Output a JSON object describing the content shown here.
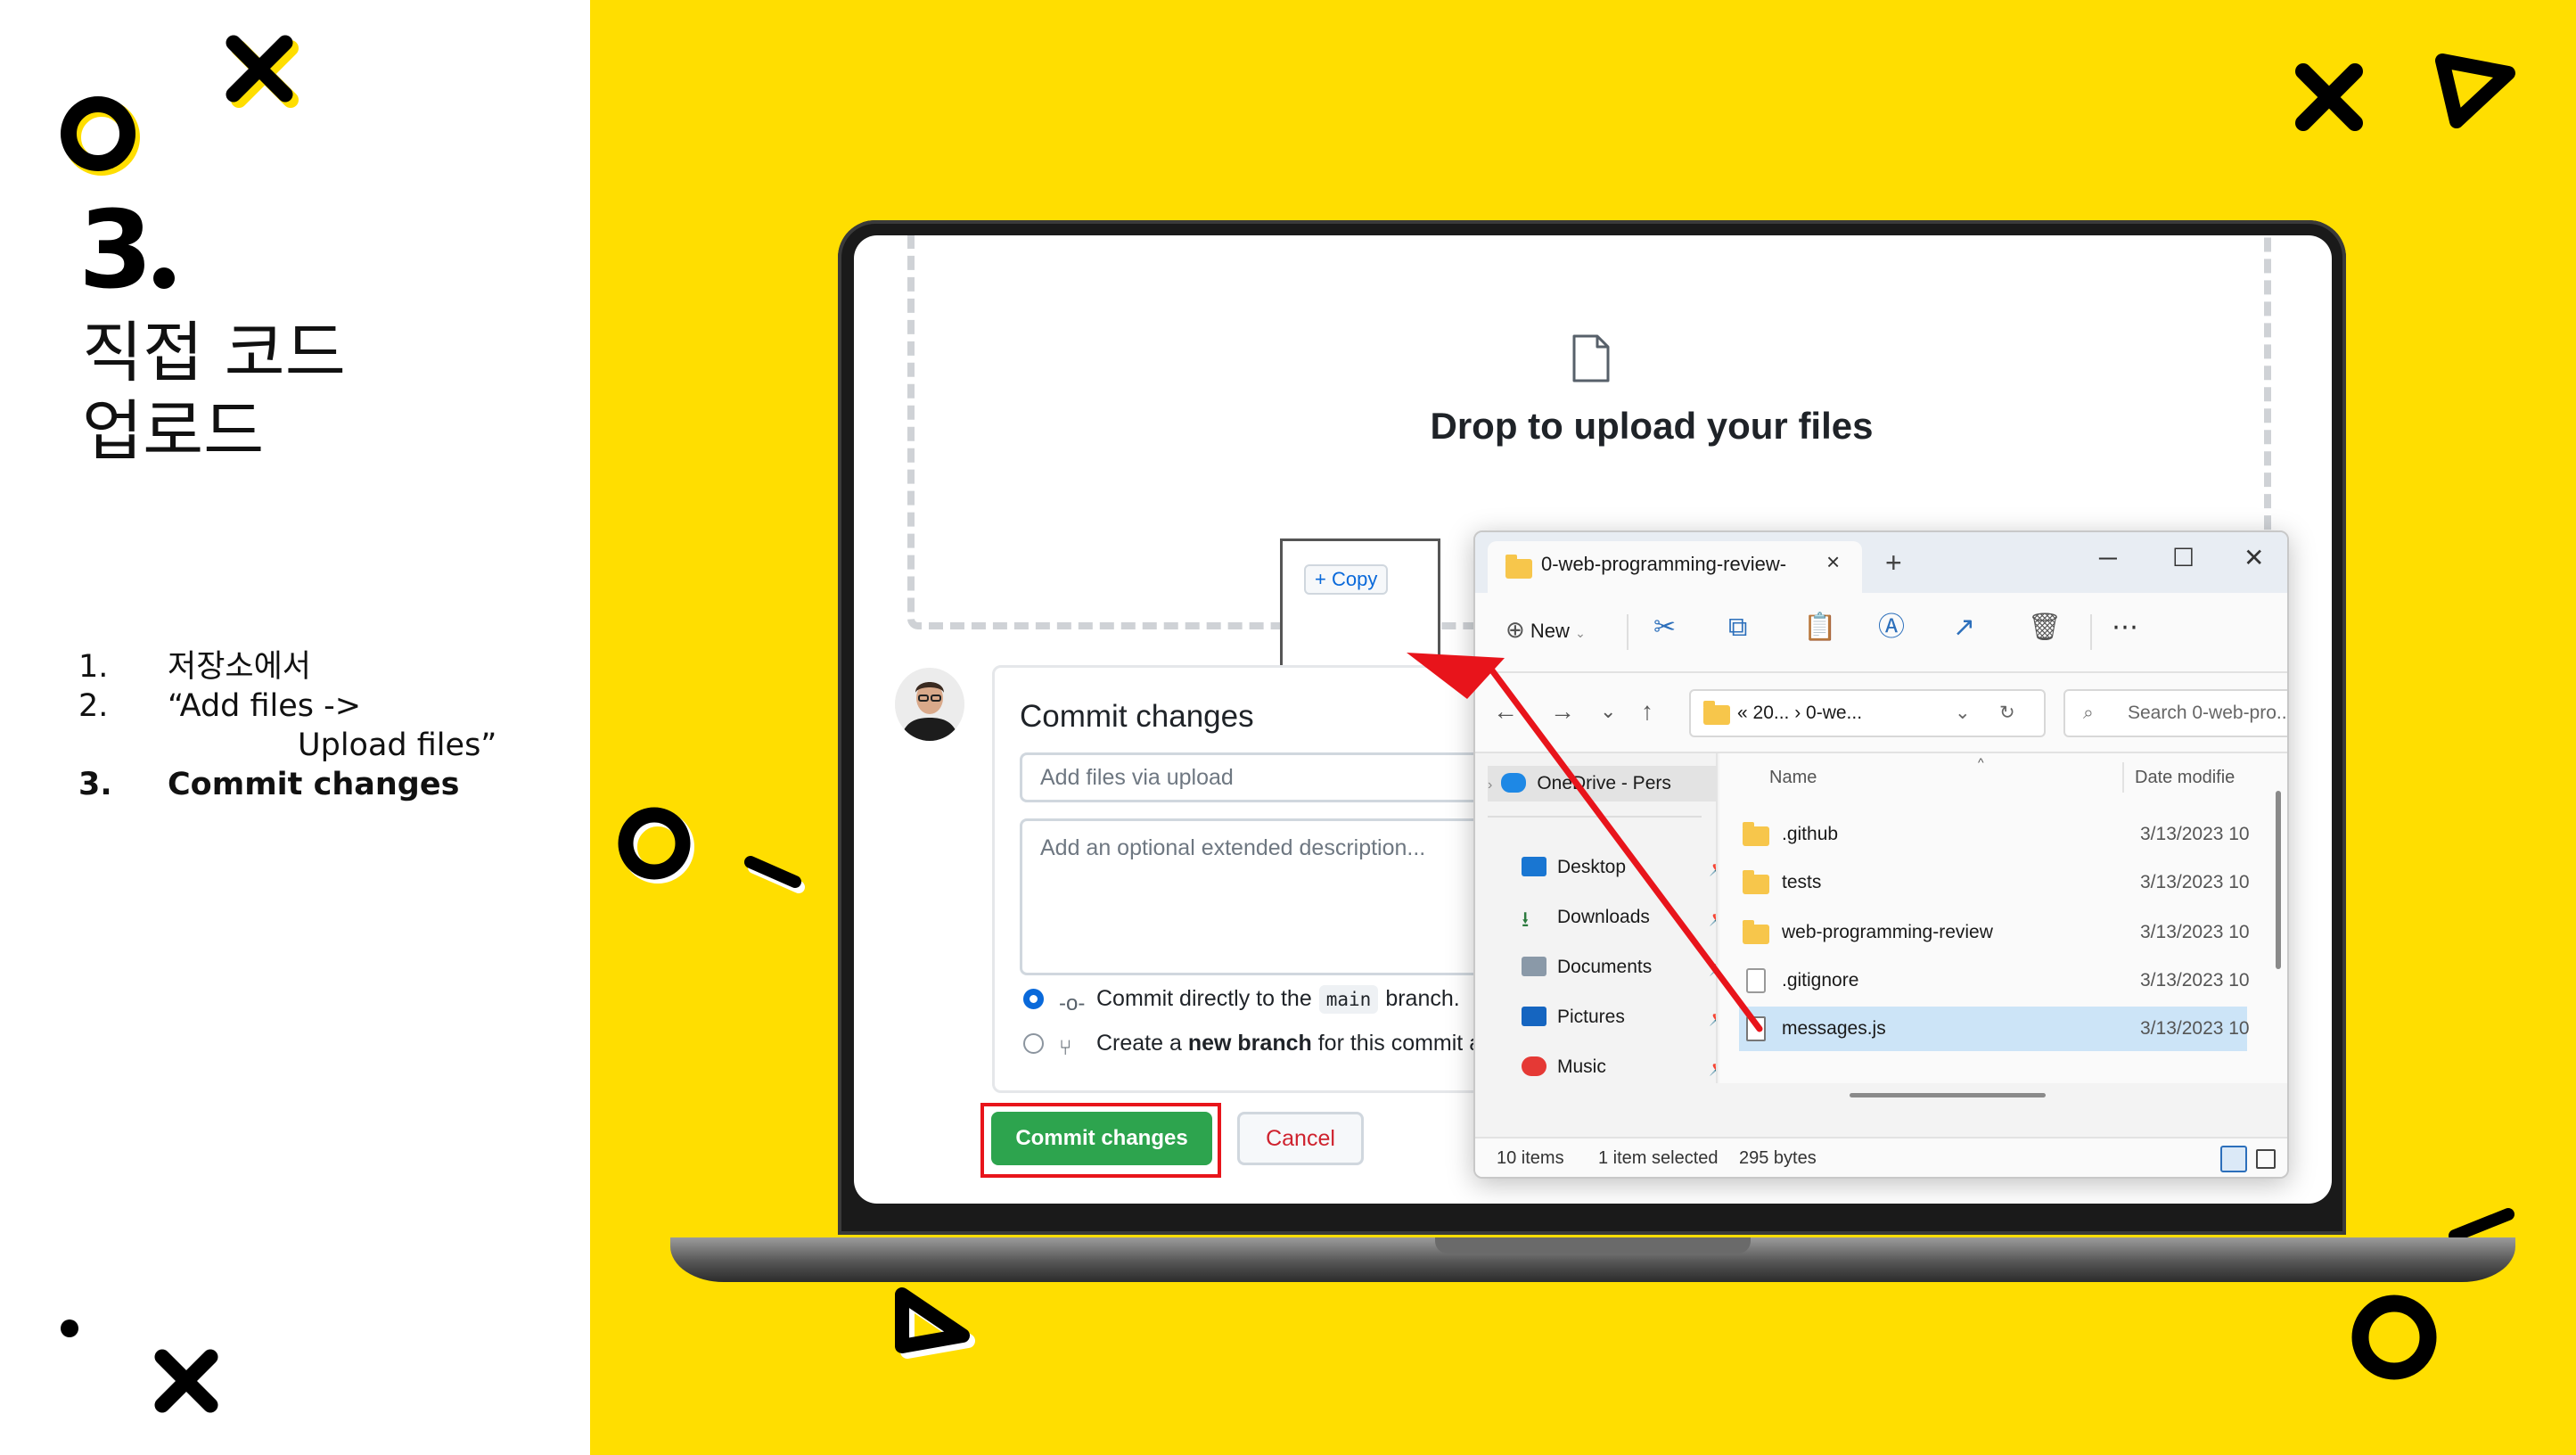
{
  "slide": {
    "number": "3",
    "title_line1": "직접 코드",
    "title_line2": "업로드",
    "steps": [
      {
        "num": "1.",
        "text": "저장소에서"
      },
      {
        "num": "2.",
        "text": "“Add files ->"
      },
      {
        "num": "",
        "text": "Upload files”"
      },
      {
        "num": "3.",
        "text": "Commit changes"
      }
    ]
  },
  "colors": {
    "background_accent": "#FFDE00",
    "commit_button": "#2da44e",
    "highlight": "#e8141b"
  },
  "github": {
    "drop_title": "Drop to upload your files",
    "drag_badge": "+ Copy",
    "commit_heading": "Commit changes",
    "summary_placeholder": "Add files via upload",
    "description_placeholder": "Add an optional extended description...",
    "option_direct_pre": "Commit directly to the",
    "option_direct_branch": "main",
    "option_direct_post": "branch.",
    "option_new_pre": "Create a",
    "option_new_bold": "new branch",
    "option_new_post": "for this commit ar",
    "commit_button": "Commit changes",
    "cancel_button": "Cancel"
  },
  "explorer": {
    "tab_title": "0-web-programming-review-",
    "tab_close": "×",
    "new_tab": "+",
    "new_label": "New",
    "breadcrumb": "«  20...  ›  0-we...",
    "search_placeholder": "Search 0-web-pro...",
    "columns": {
      "name": "Name",
      "date": "Date modifie"
    },
    "nav_items": [
      {
        "label": "OneDrive - Pers",
        "icon": "cloud-icon"
      },
      {
        "label": "Desktop",
        "icon": "desktop-icon"
      },
      {
        "label": "Downloads",
        "icon": "download-icon"
      },
      {
        "label": "Documents",
        "icon": "documents-icon"
      },
      {
        "label": "Pictures",
        "icon": "pictures-icon"
      },
      {
        "label": "Music",
        "icon": "music-icon"
      }
    ],
    "files": [
      {
        "name": ".github",
        "date": "3/13/2023 10",
        "kind": "folder"
      },
      {
        "name": "tests",
        "date": "3/13/2023 10",
        "kind": "folder"
      },
      {
        "name": "web-programming-review",
        "date": "3/13/2023 10",
        "kind": "folder"
      },
      {
        "name": ".gitignore",
        "date": "3/13/2023 10",
        "kind": "file"
      },
      {
        "name": "messages.js",
        "date": "3/13/2023 10",
        "kind": "file"
      }
    ],
    "selected_file": "messages.js",
    "status_items": "10 items",
    "status_selected": "1 item selected",
    "status_size": "295 bytes"
  }
}
